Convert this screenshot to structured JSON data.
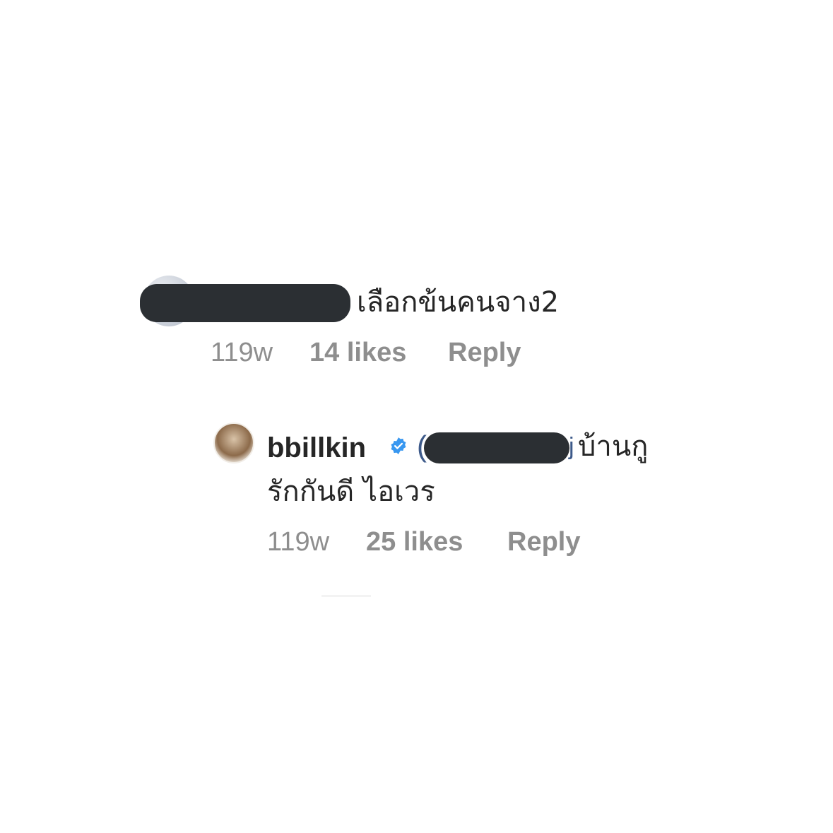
{
  "comment1": {
    "username_redacted": true,
    "text": "เลือกข้นคนจาง2",
    "time": "119w",
    "likes": "14 likes",
    "reply": "Reply"
  },
  "comment2": {
    "username": "bbillkin",
    "verified_icon": "verified-badge-icon",
    "mention_redacted": true,
    "text_line1": "บ้านกู",
    "text_line2": "รักกันดี ไอเวร",
    "time": "119w",
    "likes": "25 likes",
    "reply": "Reply"
  },
  "colors": {
    "text": "#262626",
    "meta": "#8e8e8e",
    "redaction": "#2b2f33",
    "verified": "#3897f0",
    "mention": "#3d5a8a"
  }
}
